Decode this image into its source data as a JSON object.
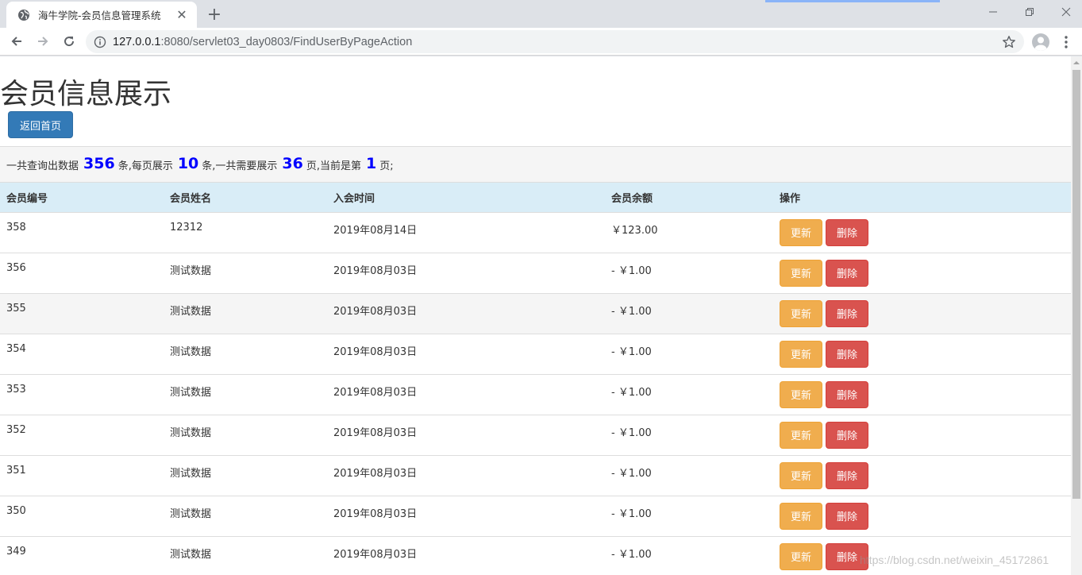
{
  "browser": {
    "tab_title": "海牛学院-会员信息管理系统",
    "url_host": "127.0.0.1",
    "url_rest": ":8080/servlet03_day0803/FindUserByPageAction"
  },
  "page": {
    "title": "会员信息展示",
    "home_button": "返回首页"
  },
  "summary": {
    "prefix": "一共查询出数据",
    "total_records": "356",
    "mid1": "条,每页展示",
    "page_size": "10",
    "mid2": "条,一共需要展示",
    "total_pages": "36",
    "mid3": "页,当前是第",
    "current_page": "1",
    "suffix": "页;"
  },
  "table": {
    "headers": [
      "会员编号",
      "会员姓名",
      "入会时间",
      "会员余额",
      "操作"
    ],
    "update_label": "更新",
    "delete_label": "删除",
    "rows": [
      {
        "id": "358",
        "name": "12312",
        "date": "2019年08月14日",
        "balance": "￥123.00"
      },
      {
        "id": "356",
        "name": "测试数据",
        "date": "2019年08月03日",
        "balance": "- ￥1.00"
      },
      {
        "id": "355",
        "name": "测试数据",
        "date": "2019年08月03日",
        "balance": "- ￥1.00"
      },
      {
        "id": "354",
        "name": "测试数据",
        "date": "2019年08月03日",
        "balance": "- ￥1.00"
      },
      {
        "id": "353",
        "name": "测试数据",
        "date": "2019年08月03日",
        "balance": "- ￥1.00"
      },
      {
        "id": "352",
        "name": "测试数据",
        "date": "2019年08月03日",
        "balance": "- ￥1.00"
      },
      {
        "id": "351",
        "name": "测试数据",
        "date": "2019年08月03日",
        "balance": "- ￥1.00"
      },
      {
        "id": "350",
        "name": "测试数据",
        "date": "2019年08月03日",
        "balance": "- ￥1.00"
      },
      {
        "id": "349",
        "name": "测试数据",
        "date": "2019年08月03日",
        "balance": "- ￥1.00"
      }
    ]
  },
  "watermark": "https://blog.csdn.net/weixin_45172861"
}
